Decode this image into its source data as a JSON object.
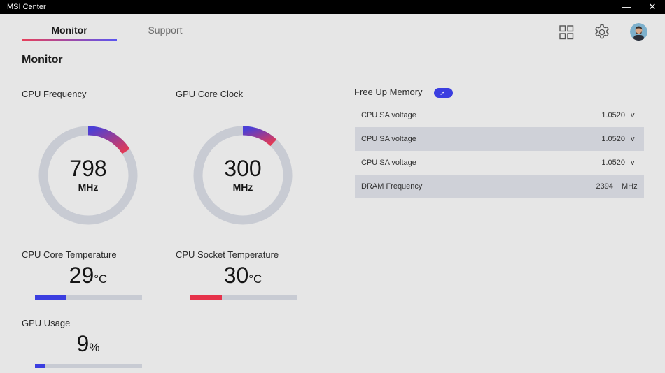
{
  "window": {
    "title": "MSI Center",
    "minimize": "—",
    "close": "✕"
  },
  "tabs": [
    {
      "label": "Monitor",
      "active": true
    },
    {
      "label": "Support",
      "active": false
    }
  ],
  "header_icons": [
    "apps-grid-icon",
    "gear-icon",
    "avatar"
  ],
  "page_title": "Monitor",
  "metrics": {
    "cpu_frequency": {
      "label": "CPU Frequency",
      "value": "798",
      "unit": "MHz",
      "gauge_fraction": 0.16
    },
    "gpu_core_clock": {
      "label": "GPU Core Clock",
      "value": "300",
      "unit": "MHz",
      "gauge_fraction": 0.12
    },
    "cpu_core_temp": {
      "label": "CPU Core Temperature",
      "value": "29",
      "unit": "°C",
      "bar_fraction": 0.29,
      "bar_color": "#3b3ee0"
    },
    "cpu_socket_temp": {
      "label": "CPU Socket Temperature",
      "value": "30",
      "unit": "°C",
      "bar_fraction": 0.3,
      "bar_color": "#e6324a"
    },
    "gpu_usage": {
      "label": "GPU Usage",
      "value": "9",
      "unit": "%",
      "bar_fraction": 0.09,
      "bar_color": "#3b3ee0"
    }
  },
  "free_up_memory": {
    "label": "Free Up Memory"
  },
  "info_rows": [
    {
      "name": "CPU SA voltage",
      "value": "1.0520",
      "unit": "v"
    },
    {
      "name": "CPU SA voltage",
      "value": "1.0520",
      "unit": "v"
    },
    {
      "name": "CPU SA voltage",
      "value": "1.0520",
      "unit": "v"
    },
    {
      "name": "DRAM Frequency",
      "value": "2394",
      "unit": "MHz"
    }
  ],
  "colors": {
    "accent_blue": "#3b3ee0",
    "accent_red": "#e6324a",
    "gauge_track": "#c8cbd3",
    "background": "#e6e6e6"
  }
}
